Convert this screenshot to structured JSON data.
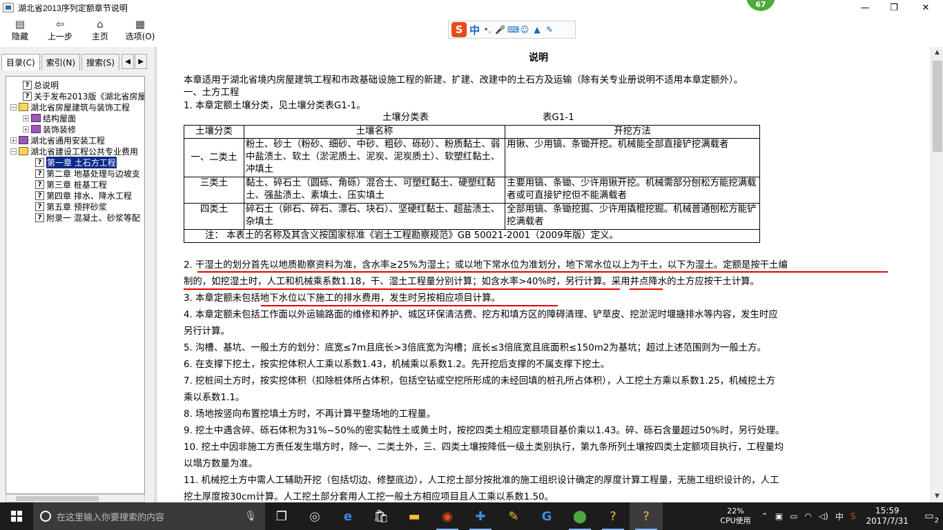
{
  "window": {
    "title": "湖北省2013序列定额章节说明",
    "badge": "67"
  },
  "toolbar": [
    {
      "label": "隐藏",
      "icon": "hide-icon"
    },
    {
      "label": "上一步",
      "icon": "back-icon"
    },
    {
      "label": "主页",
      "icon": "home-icon"
    },
    {
      "label": "选项(O)",
      "icon": "options-icon"
    }
  ],
  "ime": {
    "logo": "S",
    "mode": "中",
    "punct": "•,"
  },
  "tabs": [
    {
      "label": "目录(C)"
    },
    {
      "label": "索引(N)"
    },
    {
      "label": "搜索(S)"
    }
  ],
  "tree": [
    {
      "label": "总说明",
      "type": "topic"
    },
    {
      "label": "关于发布2013版《湖北省房屋",
      "type": "topic"
    },
    {
      "label": "湖北省房屋建筑与装饰工程",
      "type": "book",
      "exp": "⊟"
    },
    {
      "label": "结构屋面",
      "type": "pbook",
      "exp": "⊞"
    },
    {
      "label": "装饰装修",
      "type": "pbook",
      "exp": "⊞"
    },
    {
      "label": "湖北省通用安装工程",
      "type": "pbook",
      "exp": "⊞"
    },
    {
      "label": "湖北省建设工程公共专业费用",
      "type": "book",
      "exp": "⊟"
    },
    {
      "label": "第一章 土石方工程",
      "type": "topic",
      "selected": true
    },
    {
      "label": "第二章 地基处理与边坡支",
      "type": "topic"
    },
    {
      "label": "第三章 桩基工程",
      "type": "topic"
    },
    {
      "label": "第四章 排水、降水工程",
      "type": "topic"
    },
    {
      "label": "第五章 预拌砂浆",
      "type": "topic"
    },
    {
      "label": "附录一 混凝土、砂浆等配",
      "type": "topic"
    }
  ],
  "doc": {
    "title": "说明",
    "intro": "本章适用于湖北省境内房屋建筑工程和市政基础设施工程的新建、扩建、改建中的土石方及运输（除有关专业册说明不适用本章定额外）。",
    "sec1": "一、土方工程",
    "item1": "1. 本章定额土壤分类，见土壤分类表G1-1。",
    "table_caption": "土壤分类表",
    "table_no": "表G1-1",
    "table_headers": [
      "土壤分类",
      "土壤名称",
      "开挖方法"
    ],
    "table_rows": [
      {
        "cls": "一、二类土",
        "name": "粉土、砂土（粉砂、细砂、中砂、粗砂、砾砂）、粉质黏土、弱中盐渍土、软土（淤泥质土、泥炭、泥炭质土）、软塑红黏土、冲填土",
        "method": "用锹、少用镐、条锄开挖。机械能全部直接铲挖满载者"
      },
      {
        "cls": "三类土",
        "name": "黏土、碎石土（圆砾、角砾）混合土、可塑红黏土、硬塑红黏土、强盐渍土、素填土、压实填土",
        "method": "主要用镐、条锄、少许用锹开挖。机械需部分刨松方能挖满载者或可直接铲挖但不能满载者"
      },
      {
        "cls": "四类土",
        "name": "碎石土（卵石、碎石、漂石、块石）、坚硬红黏土、超盐渍土、杂填土",
        "method": "全部用镐、条锄挖掘、少许用撬棍挖掘。机械普通刨松方能铲挖满载者"
      }
    ],
    "table_note": "注： 本表土的名称及其含义按国家标准《岩土工程勘察规范》GB 50021-2001（2009年版）定义。",
    "lines": [
      "2. 干湿土的划分首先以地质勘察资料为准，含水率≥25%为湿土；或以地下常水位为准划分，地下常水位以上为干土，以下为湿土。定额是按干土编",
      "制的，如挖湿土时，人工和机械乘系数1.18，干、湿土工程量分别计算；如含水率>40%时，另行计算。采用井点降水的土方应按干土计算。",
      "3. 本章定额未包括地下水位以下施工的排水费用，发生时另按相应项目计算。",
      "4. 本章定额未包括工作面以外运输路面的维修和养护、城区环保清洁费、挖方和填方区的障碍清理、铲草皮、挖淤泥时堰搪排水等内容，发生时应",
      "另行计算。",
      "5. 沟槽、基坑、一般土方的划分：底宽≤7m且底长>3倍底宽为沟槽；底长≤3倍底宽且底面积≤150m2为基坑；超过上述范围则为一般土方。",
      "6. 在支撑下挖土，按实挖体积人工乘以系数1.43，机械乘以系数1.2。先开挖后支撑的不属支撑下挖土。",
      "7. 挖桩间土方时，按实挖体积（扣除桩体所占体积，包括空钻或空挖所形成的未经回填的桩孔所占体积），人工挖土方乘以系数1.25，机械挖土方",
      "乘以系数1.1。",
      "8. 场地按竖向布置挖填土方时，不再计算平整场地的工程量。",
      "9. 挖土中遇含碎、砾石体积为31%~50%的密实黏性土或黄土时，按挖四类土相应定额项目基价乘以1.43。碎、砾石含量超过50%时，另行处理。",
      "10. 挖土中因非施工方责任发生塌方时，除一、二类土外，三、四类土壤按降低一级土类别执行，第九条所列土壤按四类土定额项目执行，工程量均",
      "以塌方数量为准。",
      "11. 机械挖土方中需人工辅助开挖（包括切边、修整底边），人工挖土部分按批准的施工组织设计确定的厚度计算工程量，无施工组织设计的，人工",
      "挖土厚度按30cm计算。人工挖土部分套用人工挖一般土方相应项目且人工乘以系数1.50。"
    ]
  },
  "taskbar": {
    "search_placeholder": "在这里输入你要搜索的内容",
    "cpu_percent": "22%",
    "cpu_label": "CPU使用",
    "ime_indicator": "中",
    "time": "15:59",
    "date": "2017/7/31",
    "notifications": "2"
  }
}
